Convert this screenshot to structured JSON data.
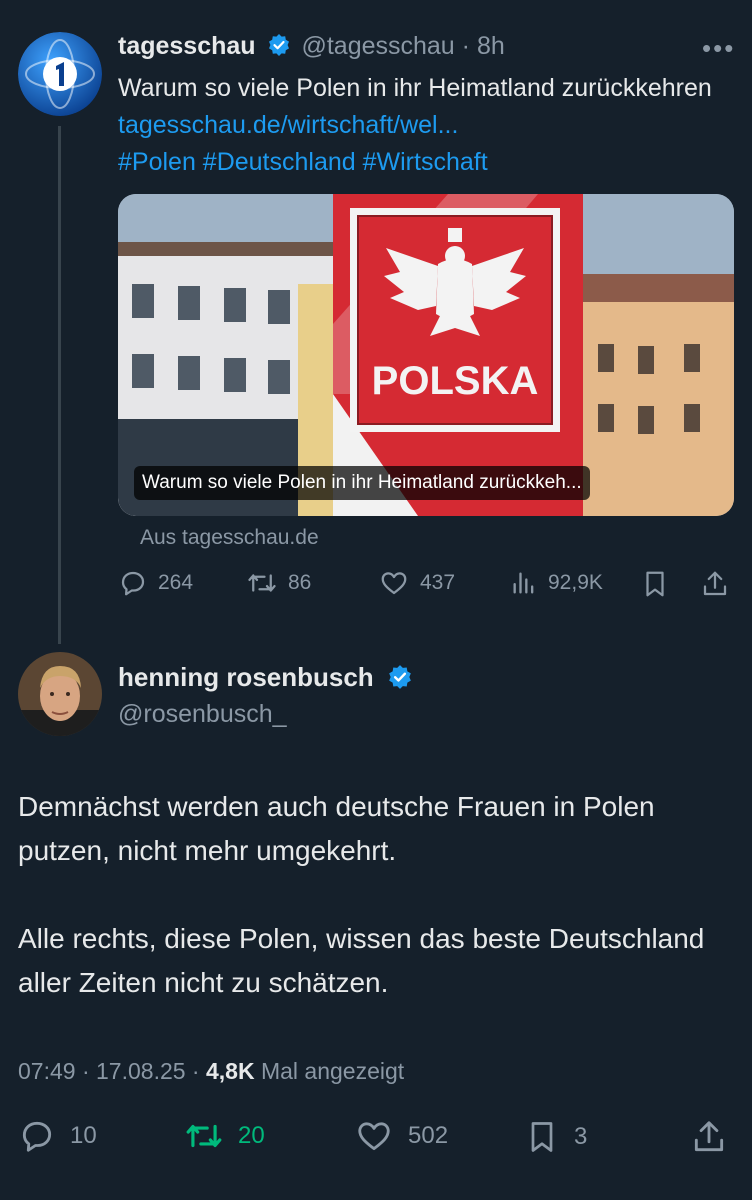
{
  "parent_tweet": {
    "display_name": "tagesschau",
    "handle": "@tagesschau",
    "time": "8h",
    "text": "Warum so viele Polen in ihr Heimatland zurückkehren",
    "link": "tagesschau.de/wirtschaft/wel...",
    "hashtags": "#Polen #Deutschland #Wirtschaft",
    "card": {
      "sign_text": "POLSKA",
      "caption": "Warum so viele Polen in ihr Heimatland zurückkeh...",
      "source": "Aus tagesschau.de"
    },
    "stats": {
      "replies": "264",
      "reposts": "86",
      "likes": "437",
      "views": "92,9K"
    }
  },
  "main_tweet": {
    "display_name": "henning rosenbusch",
    "handle": "@rosenbusch_",
    "paragraphs": [
      "Demnächst werden auch deutsche Frauen in Polen putzen, nicht mehr umgekehrt.",
      "Alle rechts, diese Polen, wissen das beste Deutschland aller Zeiten nicht zu schätzen."
    ],
    "time": "07:49",
    "date": "17.08.25",
    "views": "4,8K",
    "views_label": "Mal angezeigt",
    "stats": {
      "replies": "10",
      "reposts": "20",
      "likes": "502",
      "bookmarks": "3"
    }
  },
  "colors": {
    "background": "#15202b",
    "accent": "#1d9bf0",
    "muted": "#8b98a5",
    "repost_active": "#00ba7c",
    "thread_line": "#38444d"
  }
}
